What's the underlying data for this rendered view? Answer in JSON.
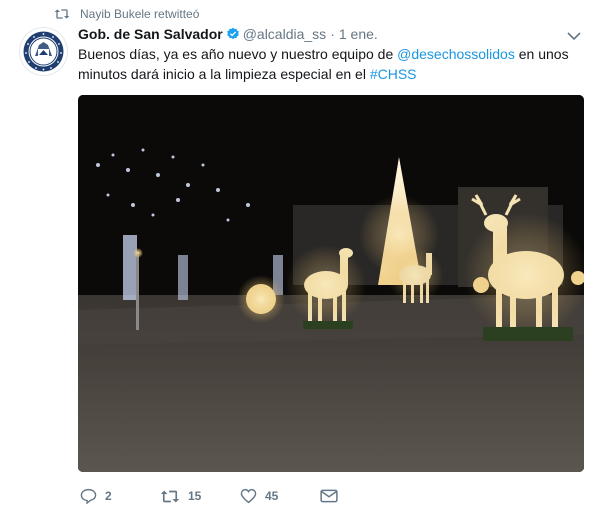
{
  "retweet": {
    "text": "Nayib Bukele retwitteó",
    "icon": "retweet-icon"
  },
  "author": {
    "name": "Gob. de San Salvador",
    "handle": "@alcaldia_ss",
    "separator": "·",
    "time": "1 ene.",
    "verified": true
  },
  "tweet": {
    "text_before": "Buenos días, ya es año nuevo y nuestro equipo de ",
    "mention": "@desechossolidos",
    "text_middle": " en unos minutos dará inicio a la limpieza especial en el ",
    "hashtag": "#CHSS"
  },
  "photo": {
    "icon": "christmas-lights-photo"
  },
  "actions": {
    "reply_count": "2",
    "retweet_count": "15",
    "like_count": "45"
  },
  "colors": {
    "link": "#1b95e0",
    "verified": "#1da1f2",
    "muted": "#657786"
  }
}
